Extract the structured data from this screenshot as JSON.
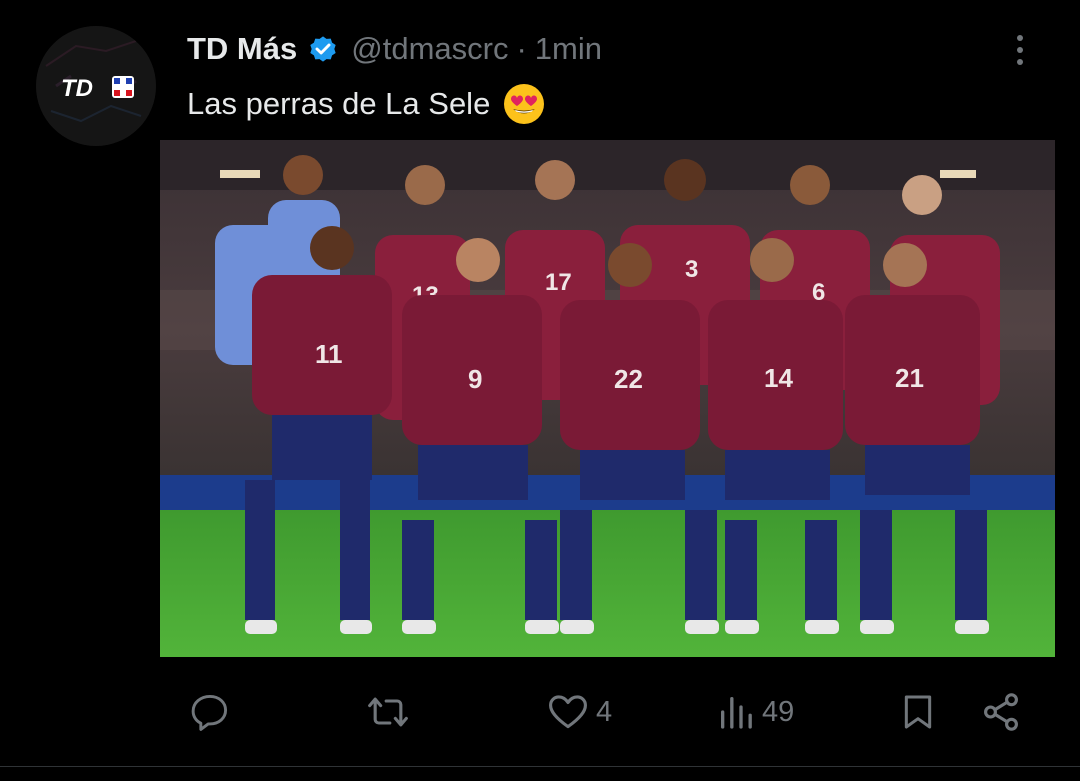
{
  "author": {
    "name": "TD Más",
    "handle": "@tdmascrc",
    "time": "1min",
    "separator": "·",
    "avatar_logo_text": "TD",
    "verified_color": "#1d9bf0"
  },
  "tweet": {
    "text": "Las perras de La Sele",
    "emoji": "heart-eyes-emoji"
  },
  "media": {
    "description_icon": "team-photo-image",
    "jersey_numbers": [
      "13",
      "17",
      "3",
      "6",
      "11",
      "9",
      "22",
      "14",
      "21"
    ]
  },
  "actions": {
    "reply": {
      "icon": "reply-icon",
      "count": ""
    },
    "repost": {
      "icon": "repost-icon",
      "count": ""
    },
    "like": {
      "icon": "heart-icon",
      "count": "4"
    },
    "views": {
      "icon": "views-icon",
      "count": "49"
    },
    "bookmark": {
      "icon": "bookmark-icon"
    },
    "share": {
      "icon": "share-icon"
    }
  },
  "colors": {
    "background": "#000000",
    "text": "#e7e9ea",
    "secondary": "#71767b",
    "jersey": "#8a1f3c",
    "shorts": "#1f2a6b",
    "pitch": "#4aa334"
  }
}
